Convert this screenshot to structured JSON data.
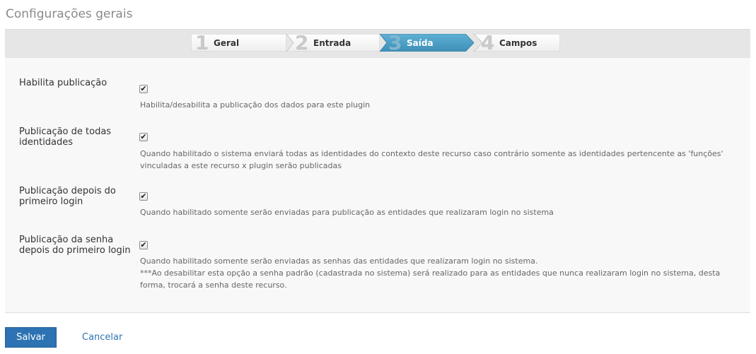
{
  "page": {
    "title": "Configurações gerais"
  },
  "wizard": {
    "steps": [
      {
        "number": "1",
        "label": "Geral",
        "active": false
      },
      {
        "number": "2",
        "label": "Entrada",
        "active": false
      },
      {
        "number": "3",
        "label": "Saída",
        "active": true
      },
      {
        "number": "4",
        "label": "Campos",
        "active": false
      }
    ]
  },
  "settings": [
    {
      "label": "Habilita publicação",
      "checked": true,
      "desc": "Habilita/desabilita a publicação dos dados para este plugin"
    },
    {
      "label": "Publicação de todas identidades",
      "checked": true,
      "desc": "Quando habilitado o sistema enviará todas as identidades do contexto deste recurso caso contrário somente as identidades pertencente as 'funções' vinculadas a este recurso x plugin serão publicadas"
    },
    {
      "label": "Publicação depois do primeiro login",
      "checked": true,
      "desc": "Quando habilitado somente serão enviadas para publicação as entidades que realizaram login no sistema"
    },
    {
      "label": "Publicação da senha depois do primeiro login",
      "checked": true,
      "desc_line1": "Quando habilitado somente serão enviadas as senhas das entidades que realizaram login no sistema.",
      "desc_line2": "***Ao desabilitar esta opção a senha padrão (cadastrada no sistema) será realizado para as entidades que nunca realizaram login no sistema, desta forma, trocará a senha deste recurso."
    }
  ],
  "actions": {
    "save_label": "Salvar",
    "cancel_label": "Cancelar"
  },
  "icons": {
    "checkbox_checked": "check-icon"
  },
  "colors": {
    "accent": "#2d73b3",
    "active_step": "#4a9fc6"
  }
}
